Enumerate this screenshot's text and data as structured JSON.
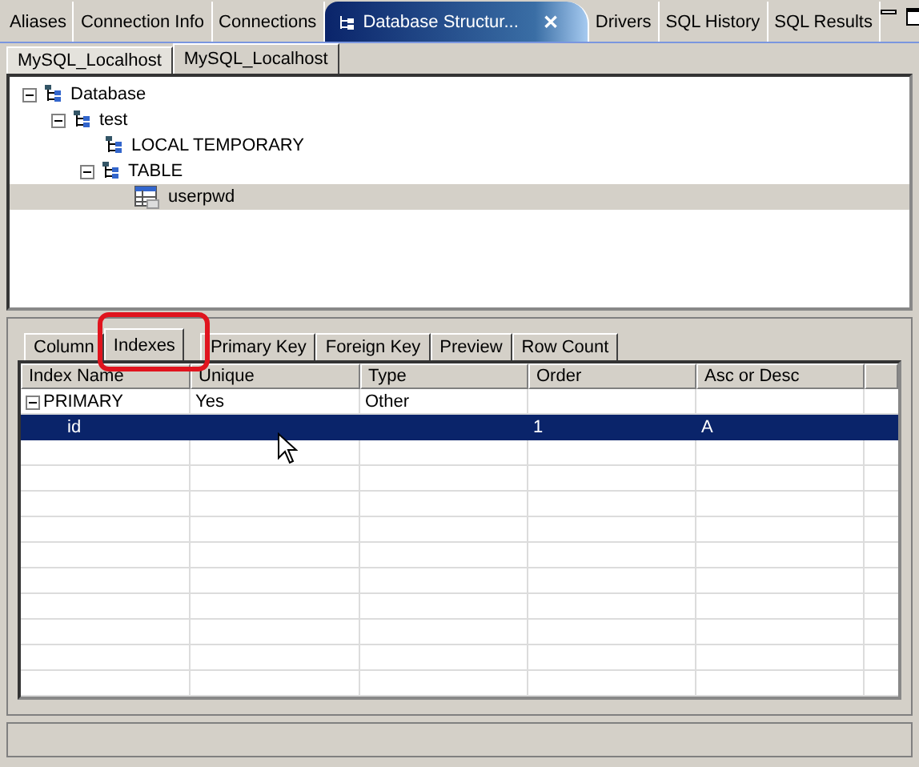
{
  "view_tabs": [
    {
      "label": "Aliases",
      "selected": false
    },
    {
      "label": "Connection Info",
      "selected": false
    },
    {
      "label": "Connections",
      "selected": false
    },
    {
      "label": "Database Structur...",
      "selected": true,
      "close": "✕"
    },
    {
      "label": "Drivers",
      "selected": false
    },
    {
      "label": "SQL History",
      "selected": false
    },
    {
      "label": "SQL Results",
      "selected": false
    }
  ],
  "connection_tabs": [
    {
      "label": "MySQL_Localhost",
      "selected": false
    },
    {
      "label": "MySQL_Localhost",
      "selected": true
    }
  ],
  "tree": [
    {
      "label": "Database",
      "kind": "schema",
      "expanded": true,
      "selected": false,
      "children": [
        {
          "label": "test",
          "kind": "schema",
          "expanded": true,
          "selected": false,
          "children": [
            {
              "label": "LOCAL TEMPORARY",
              "kind": "schema",
              "selected": false
            },
            {
              "label": "TABLE",
              "kind": "schema",
              "expanded": true,
              "selected": false,
              "children": [
                {
                  "label": "userpwd",
                  "kind": "table",
                  "selected": true
                }
              ]
            }
          ]
        }
      ]
    }
  ],
  "detail_tabs": [
    {
      "label": "Column",
      "selected": false
    },
    {
      "label": "Indexes",
      "selected": true
    },
    {
      "label": "Primary Key",
      "selected": false
    },
    {
      "label": "Foreign Key",
      "selected": false
    },
    {
      "label": "Preview",
      "selected": false
    },
    {
      "label": "Row Count",
      "selected": false
    }
  ],
  "table": {
    "columns": [
      "Index Name",
      "Unique",
      "Type",
      "Order",
      "Asc or Desc"
    ],
    "rows": [
      {
        "name": "PRIMARY",
        "unique": "Yes",
        "type": "Other",
        "expanded": true,
        "selected": false,
        "children": [
          {
            "name": "id",
            "order": "1",
            "direction": "A",
            "selected": true
          }
        ]
      }
    ]
  }
}
